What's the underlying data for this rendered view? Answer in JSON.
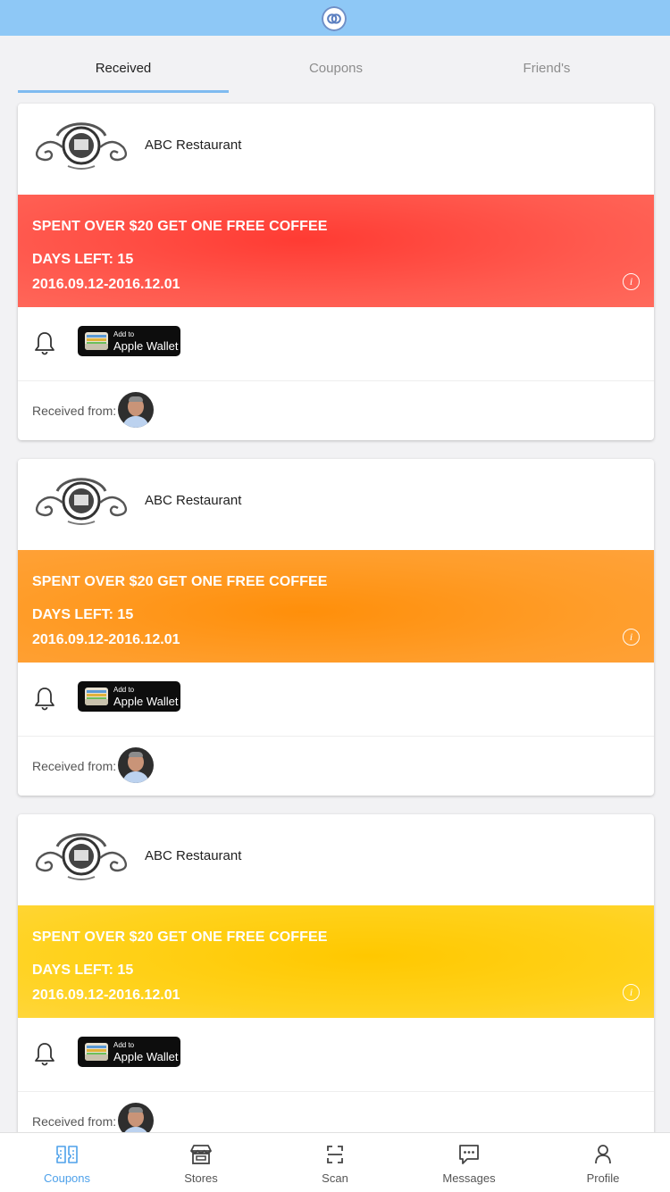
{
  "tabs": [
    {
      "label": "Received",
      "active": true
    },
    {
      "label": "Coupons",
      "active": false
    },
    {
      "label": "Friend's",
      "active": false
    }
  ],
  "coupons": [
    {
      "store_name": "ABC Restaurant",
      "offer": "SPENT OVER $20 GET ONE FREE COFFEE",
      "days_left": "DAYS LEFT: 15",
      "dates": "2016.09.12-2016.12.01",
      "banner_color": "#ff4a40",
      "wallet_small": "Add to",
      "wallet_big": "Apple Wallet",
      "received_from": "Received from:"
    },
    {
      "store_name": "ABC Restaurant",
      "offer": "SPENT OVER $20 GET ONE FREE COFFEE",
      "days_left": "DAYS LEFT: 15",
      "dates": "2016.09.12-2016.12.01",
      "banner_color": "#ff9a1f",
      "wallet_small": "Add to",
      "wallet_big": "Apple Wallet",
      "received_from": "Received from:"
    },
    {
      "store_name": "ABC Restaurant",
      "offer": "SPENT OVER $20 GET ONE FREE COFFEE",
      "days_left": "DAYS LEFT: 15",
      "dates": "2016.09.12-2016.12.01",
      "banner_color": "#ffd01a",
      "wallet_small": "Add to",
      "wallet_big": "Apple Wallet",
      "received_from": "Received from:"
    }
  ],
  "bottom_nav": [
    {
      "label": "Coupons",
      "icon": "coupons-icon",
      "active": true
    },
    {
      "label": "Stores",
      "icon": "store-icon",
      "active": false
    },
    {
      "label": "Scan",
      "icon": "scan-icon",
      "active": false
    },
    {
      "label": "Messages",
      "icon": "messages-icon",
      "active": false
    },
    {
      "label": "Profile",
      "icon": "profile-icon",
      "active": false
    }
  ],
  "colors": {
    "top_bar": "#8ec8f6",
    "accent": "#4ea1ea",
    "tab_indicator": "#7fbbf0"
  }
}
